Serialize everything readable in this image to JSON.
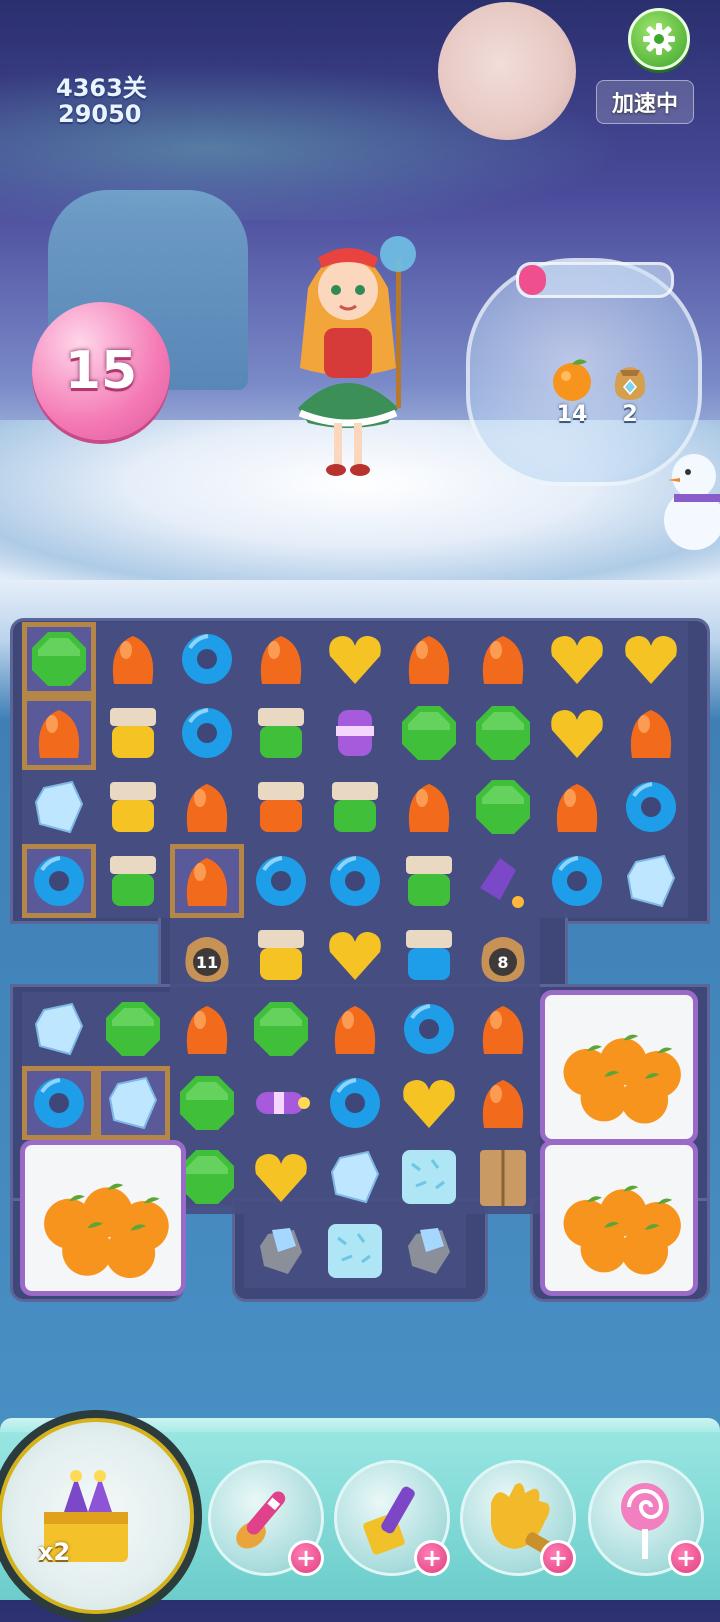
{
  "hud": {
    "level": "4363关",
    "score": "29050",
    "speed_label": "加速中",
    "moves_left": "15"
  },
  "goals": [
    {
      "name": "orange-icon",
      "count": "14"
    },
    {
      "name": "money-bag-icon",
      "count": "2"
    }
  ],
  "goal_jar_progress": 0.18,
  "board": {
    "counters": [
      {
        "name": "sack-counter-left",
        "value": "11"
      },
      {
        "name": "sack-counter-right",
        "value": "8"
      }
    ]
  },
  "boosters": [
    {
      "name": "rocket-multiplier",
      "label": "x2"
    },
    {
      "name": "spoon-booster",
      "label": "+"
    },
    {
      "name": "hammer-booster",
      "label": "+"
    },
    {
      "name": "glove-booster",
      "label": "+"
    },
    {
      "name": "lollipop-booster",
      "label": "+"
    }
  ],
  "colors": {
    "candy_orange": "#f26b1d",
    "candy_green": "#3fbf3a",
    "candy_blue": "#1e9de8",
    "candy_yellow": "#f6c324",
    "board": "#3f4778",
    "moves_pink": "#f47ab5",
    "settings_green": "#3da62d"
  }
}
